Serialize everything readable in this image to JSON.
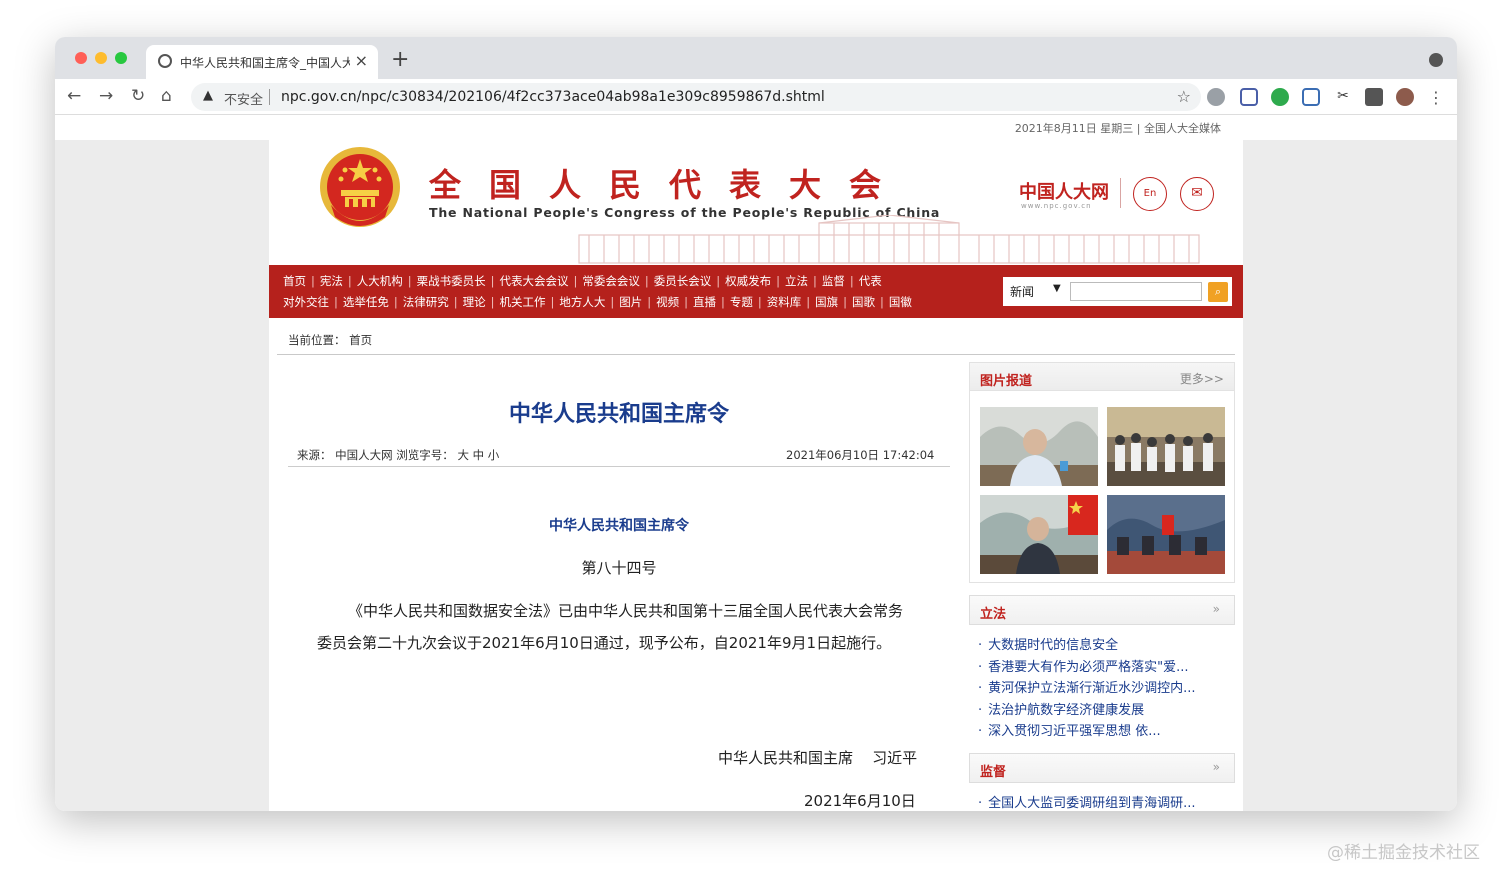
{
  "browser": {
    "tab_title": "中华人民共和国主席令_中国人大",
    "close_glyph": "×",
    "new_tab_glyph": "+",
    "insecure_label": "不安全",
    "url": "npc.gov.cn/npc/c30834/202106/4f2cc373ace04ab98a1e309c8959867d.shtml"
  },
  "topbar": {
    "date_text": "2021年8月11日 星期三 | 全国人大全媒体"
  },
  "header": {
    "title_cn": "全国人民代表大会",
    "title_en": "The National People's Congress of the People's Republic of China",
    "logo_text": "中国人大网",
    "logo_url": "www.npc.gov.cn",
    "en_button": "En"
  },
  "nav": {
    "row1": [
      "首页",
      "宪法",
      "人大机构",
      "栗战书委员长",
      "代表大会会议",
      "常委会会议",
      "委员长会议",
      "权威发布",
      "立法",
      "监督",
      "代表"
    ],
    "row2": [
      "对外交往",
      "选举任免",
      "法律研究",
      "理论",
      "机关工作",
      "地方人大",
      "图片",
      "视频",
      "直播",
      "专题",
      "资料库",
      "国旗",
      "国歌",
      "国徽"
    ],
    "search_select": "新闻"
  },
  "breadcrumb": {
    "label": "当前位置：",
    "current": "首页"
  },
  "article": {
    "title": "中华人民共和国主席令",
    "meta_source": "来源：  中国人大网   浏览字号：  大  中  小",
    "date": "2021年06月10日 17:42:04",
    "sub_title": "中华人民共和国主席令",
    "number": "第八十四号",
    "body": "《中华人民共和国数据安全法》已由中华人民共和国第十三届全国人民代表大会常务委员会第二十九次会议于2021年6月10日通过，现予公布，自2021年9月1日起施行。",
    "signature": "中华人民共和国主席    习近平",
    "sign_date": "2021年6月10日"
  },
  "sidebar": {
    "photos_title": "图片报道",
    "photos_more": "更多>>",
    "lifa_title": "立法",
    "lifa_items": [
      "大数据时代的信息安全",
      "香港要大有作为必须严格落实\"爱...",
      "黄河保护立法渐行渐近水沙调控内...",
      "法治护航数字经济健康发展",
      "深入贯彻习近平强军思想  依..."
    ],
    "jiandu_title": "监督",
    "jiandu_items": [
      "全国人大监司委调研组到青海调研..."
    ],
    "chevron": "»"
  },
  "watermark": "@稀土掘金技术社区"
}
